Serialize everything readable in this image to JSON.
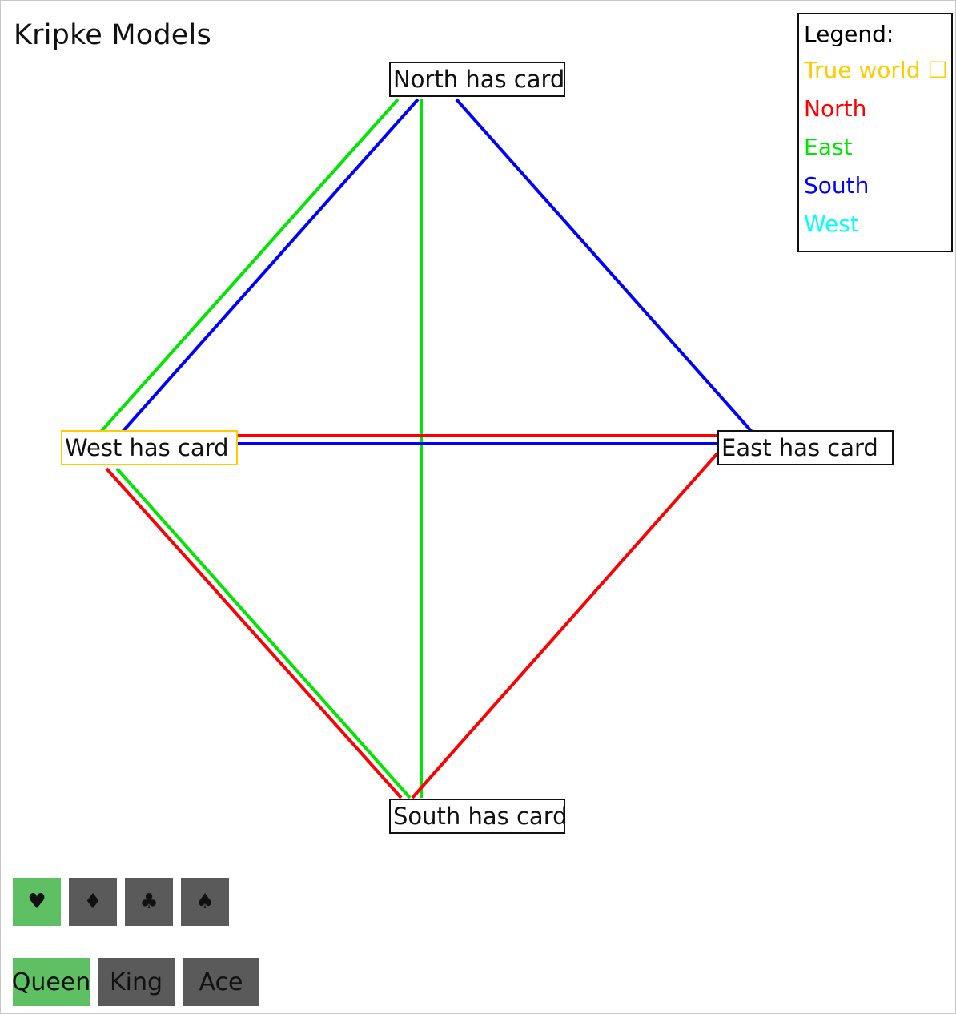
{
  "title": "Kripke Models",
  "worlds": {
    "north": "North has card",
    "east": "East has card",
    "south": "South has card",
    "west": "West has card"
  },
  "legend": {
    "heading": "Legend:",
    "true_world": "True world ☐",
    "north": "North",
    "east": "East",
    "south": "South",
    "west": "West"
  },
  "colors": {
    "true_world": "#ffcc00",
    "north": "#ff0000",
    "east": "#00e600",
    "south": "#0000ff",
    "west": "#00ffff",
    "button_active": "#5ec062",
    "button_inactive": "#5a5a5a"
  },
  "suits": [
    {
      "symbol": "♥",
      "icon": "heart-icon",
      "active": true
    },
    {
      "symbol": "♦",
      "icon": "diamond-icon",
      "active": false
    },
    {
      "symbol": "♣",
      "icon": "club-icon",
      "active": false
    },
    {
      "symbol": "♠",
      "icon": "spade-icon",
      "active": false
    }
  ],
  "ranks": [
    {
      "label": "Queen",
      "active": true
    },
    {
      "label": "King",
      "active": false
    },
    {
      "label": "Ace",
      "active": false
    }
  ],
  "true_world": "west",
  "relations": [
    {
      "agent": "east",
      "from": "north",
      "to": "west"
    },
    {
      "agent": "south",
      "from": "north",
      "to": "west"
    },
    {
      "agent": "east",
      "from": "north",
      "to": "south"
    },
    {
      "agent": "south",
      "from": "north",
      "to": "east"
    },
    {
      "agent": "north",
      "from": "west",
      "to": "east"
    },
    {
      "agent": "south",
      "from": "west",
      "to": "east"
    },
    {
      "agent": "north",
      "from": "west",
      "to": "south"
    },
    {
      "agent": "east",
      "from": "west",
      "to": "south"
    },
    {
      "agent": "north",
      "from": "east",
      "to": "south"
    }
  ]
}
